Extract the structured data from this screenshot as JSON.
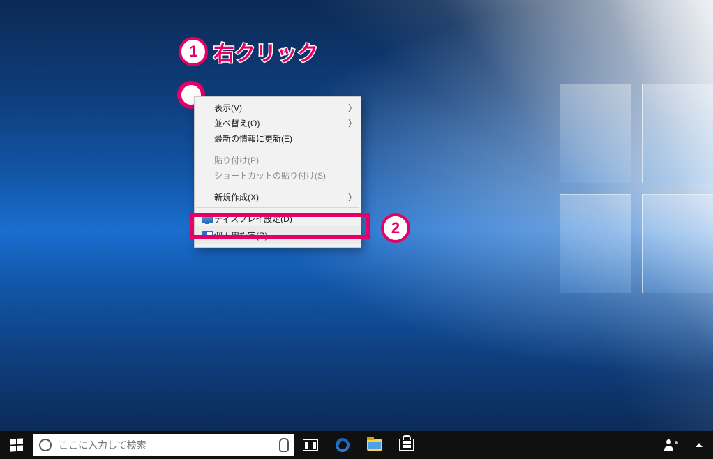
{
  "annotations": {
    "step1_number": "1",
    "step1_text": "右クリック",
    "step2_number": "2"
  },
  "context_menu": {
    "view": "表示(V)",
    "sort": "並べ替え(O)",
    "refresh": "最新の情報に更新(E)",
    "paste": "貼り付け(P)",
    "paste_shortcut": "ショートカットの貼り付け(S)",
    "new": "新規作成(X)",
    "display_settings": "ディスプレイ設定(D)",
    "personalize": "個人用設定(R)"
  },
  "taskbar": {
    "search_placeholder": "ここに入力して検索"
  }
}
